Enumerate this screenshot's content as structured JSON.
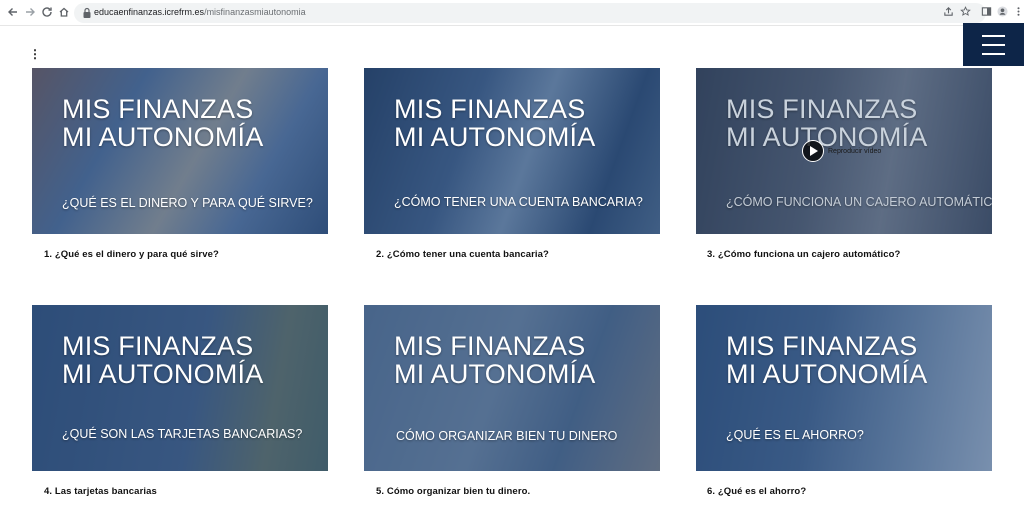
{
  "browser": {
    "url_host": "educaenfinanzas.icrefrm.es",
    "url_path": "/misfinanzasmiautonomia"
  },
  "cards": [
    {
      "title_line1": "MIS FINANZAS",
      "title_line2": "MI AUTONOMÍA",
      "subtitle": "¿QUÉ ES EL DINERO Y PARA QUÉ SIRVE?",
      "caption": "1. ¿Qué es el dinero y para qué sirve?",
      "bg": "#7a8fa8"
    },
    {
      "title_line1": "MIS FINANZAS",
      "title_line2": "MI AUTONOMÍA",
      "subtitle": "¿CÓMO TENER UNA CUENTA BANCARIA?",
      "caption": "2. ¿Cómo tener una cuenta bancaria?",
      "bg": "#3f5676"
    },
    {
      "title_line1": "MIS FINANZAS",
      "title_line2": "MI AUTONOMÍA",
      "subtitle": "¿CÓMO FUNCIONA UN CAJERO AUTOMÁTICO?",
      "caption": "3. ¿Cómo funciona un cajero automático?",
      "play_label": "Reproducir vídeo",
      "bg": "#4f5f74"
    },
    {
      "title_line1": "MIS FINANZAS",
      "title_line2": "MI AUTONOMÍA",
      "subtitle": "¿QUÉ SON LAS TARJETAS BANCARIAS?",
      "caption": "4. Las tarjetas bancarias",
      "bg": "#4d6788"
    },
    {
      "title_line1": "MIS FINANZAS",
      "title_line2": "MI AUTONOMÍA",
      "subtitle": "CÓMO ORGANIZAR BIEN TU DINERO",
      "caption": "5. Cómo organizar bien tu dinero.",
      "bg": "#6e8092"
    },
    {
      "title_line1": "MIS FINANZAS",
      "title_line2": "MI AUTONOMÍA",
      "subtitle": "¿QUÉ ES EL AHORRO?",
      "caption": "6. ¿Qué es el ahorro?",
      "bg": "#5a7393"
    }
  ],
  "colors": {
    "menu_bg": "#0d2548",
    "overlay": "#1e4476"
  },
  "icons": [
    "back-arrow-icon",
    "forward-arrow-icon",
    "reload-icon",
    "home-icon",
    "lock-icon",
    "share-icon",
    "star-icon",
    "sidebar-icon",
    "profile-icon",
    "more-vert-icon",
    "hamburger-menu-icon",
    "play-icon"
  ]
}
